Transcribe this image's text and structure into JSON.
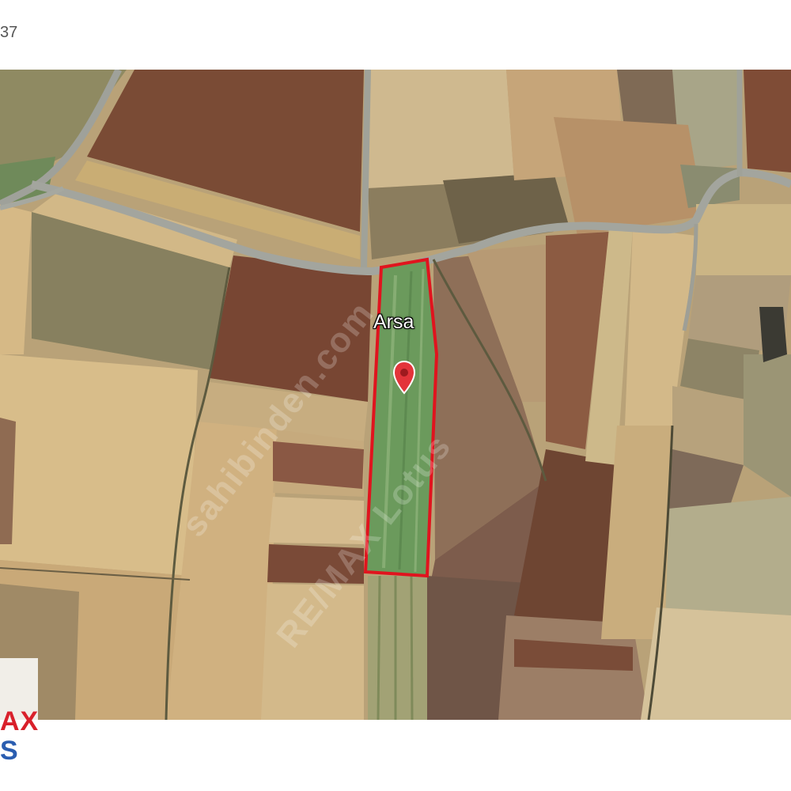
{
  "header": {
    "fragment": "37"
  },
  "map": {
    "parcel_label": "Arsa",
    "parcel_outline_color": "#e0141e",
    "pin_color": "#e3343a",
    "pin_icon": "map-pin-icon"
  },
  "watermark": {
    "line1": "sahibinden.com",
    "line2": "RE/MAX Lotus"
  },
  "branding": {
    "line1": "AX",
    "line2": "S"
  }
}
